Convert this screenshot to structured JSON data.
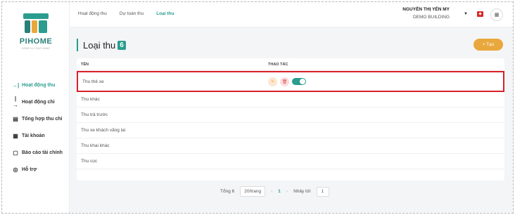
{
  "brand": {
    "name": "PIHOME",
    "tagline": "HOME IN YOUR HAND"
  },
  "nav": [
    {
      "label": "Hoạt động thu",
      "icon": "→|",
      "active": true
    },
    {
      "label": "Hoạt động chi",
      "icon": "|→",
      "active": false
    },
    {
      "label": "Tổng hợp thu chi",
      "icon": "▤",
      "active": false
    },
    {
      "label": "Tài khoản",
      "icon": "▦",
      "active": false
    },
    {
      "label": "Báo cáo tài chính",
      "icon": "▢",
      "active": false
    },
    {
      "label": "Hỗ trợ",
      "icon": "◎",
      "active": false
    }
  ],
  "tabs": [
    {
      "label": "Hoạt động thu",
      "active": false
    },
    {
      "label": "Dự toán thu",
      "active": false
    },
    {
      "label": "Loại thu",
      "active": true
    }
  ],
  "user": {
    "name": "NGUYỄN THỊ YẾN MY",
    "building": "DEMO BUILDING"
  },
  "page": {
    "title": "Loại thu",
    "count": "6",
    "add_label": "+ Tạo"
  },
  "table": {
    "headers": [
      "TÊN",
      "THAO TÁC"
    ],
    "rows": [
      "Thu thẻ xe",
      "Thu khác",
      "Thu trả trước",
      "Thu xe khách vãng lai",
      "Thu khai khác",
      "Thu cọc"
    ]
  },
  "pager": {
    "total": "Tổng 6",
    "page_size": "20/trang",
    "current": "1",
    "jump_label": "Nhảy tới",
    "jump_value": "1"
  },
  "colors": {
    "accent": "#2a9d8f",
    "add_button": "#e9a83c",
    "highlight": "#d9202a"
  }
}
